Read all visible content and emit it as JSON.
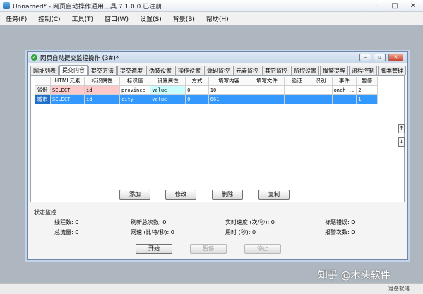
{
  "window": {
    "title": "Unnamed* - 网页自动操作通用工具 7.1.0.0  已注册"
  },
  "menu": [
    "任务(F)",
    "控制(C)",
    "工具(T)",
    "窗口(W)",
    "设置(S)",
    "背景(B)",
    "帮助(H)"
  ],
  "dialog": {
    "title": "网页自动提交监控操作  (3#)*",
    "tabs": [
      "网址列表",
      "提交内容",
      "提交方法",
      "提交速度",
      "伪装设置",
      "操作设置",
      "源码监控",
      "元素监控",
      "其它监控",
      "监控设置",
      "报警提醒",
      "流程控制",
      "脚本管理"
    ],
    "grid": {
      "columns": [
        "HTML元素",
        "标识属性",
        "标识值",
        "设置属性",
        "方式",
        "填写内容",
        "填写文件",
        "验证",
        "识别",
        "事件",
        "暂停"
      ],
      "rows": [
        {
          "label": "省份",
          "cells": [
            "SELECT",
            "id",
            "province",
            "value",
            "0",
            "10",
            "",
            "",
            "",
            "onch...",
            "2"
          ]
        },
        {
          "label": "城市",
          "cells": [
            "SELECT",
            "id",
            "city",
            "value",
            "0",
            "661",
            "",
            "",
            "",
            "",
            "1"
          ]
        }
      ],
      "scroll_up": "↑",
      "scroll_down": "↓"
    },
    "actions": {
      "add": "添加",
      "edit": "修改",
      "delete": "删除",
      "copy": "复制"
    },
    "status": {
      "label": "状态监控",
      "threads": "线程数:  0",
      "refresh_total": "刷新总次数:  0",
      "realtime_speed": "实时速度 (次/秒):  0",
      "title_error": "标题错误:  0",
      "total_traffic": "总流量:  0",
      "net_speed": "网速 (比特/秒):  0",
      "time_used": "用时 (秒):  0",
      "alarm_count": "报警次数:  0"
    },
    "bottom": {
      "start": "开始",
      "pause": "暂停",
      "stop": "停止"
    }
  },
  "statusbar": {
    "ready": "准备就绪"
  },
  "watermark": "知乎 @木头软件"
}
